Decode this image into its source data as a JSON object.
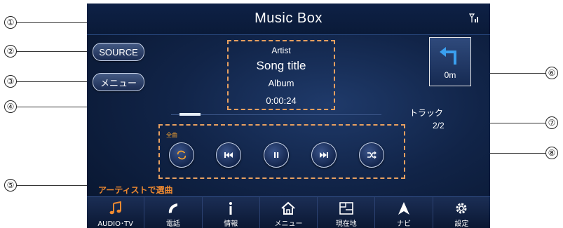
{
  "callouts": [
    "①",
    "②",
    "③",
    "④",
    "⑤",
    "⑥",
    "⑦",
    "⑧"
  ],
  "header": {
    "title": "Music Box",
    "signal_icon": "signal-icon"
  },
  "buttons": {
    "source": "SOURCE",
    "menu": "メニュー"
  },
  "now_playing": {
    "artist": "Artist",
    "song": "Song title",
    "album": "Album",
    "time": "0:00:24"
  },
  "navigation": {
    "turn_icon": "turn-left-arrow-icon",
    "distance": "0m"
  },
  "track": {
    "label": "トラック",
    "count": "2/2"
  },
  "controls": {
    "repeat_label": "全曲",
    "buttons": [
      {
        "name": "repeat",
        "icon": "repeat-icon"
      },
      {
        "name": "previous",
        "icon": "previous-track-icon"
      },
      {
        "name": "pause",
        "icon": "pause-icon"
      },
      {
        "name": "next",
        "icon": "next-track-icon"
      },
      {
        "name": "shuffle",
        "icon": "shuffle-icon"
      }
    ]
  },
  "hint": "アーティストで選曲",
  "bottom_nav": [
    {
      "label": "AUDIO･TV",
      "icon": "music-note-icon"
    },
    {
      "label": "電話",
      "icon": "phone-icon"
    },
    {
      "label": "情報",
      "icon": "info-icon"
    },
    {
      "label": "メニュー",
      "icon": "home-icon"
    },
    {
      "label": "現在地",
      "icon": "map-location-icon"
    },
    {
      "label": "ナビ",
      "icon": "navigation-arrow-icon"
    },
    {
      "label": "設定",
      "icon": "settings-gear-icon"
    }
  ],
  "colors": {
    "accent": "#f08a30",
    "highlight_box": "#e8a060",
    "screen_bg": "#112448"
  }
}
